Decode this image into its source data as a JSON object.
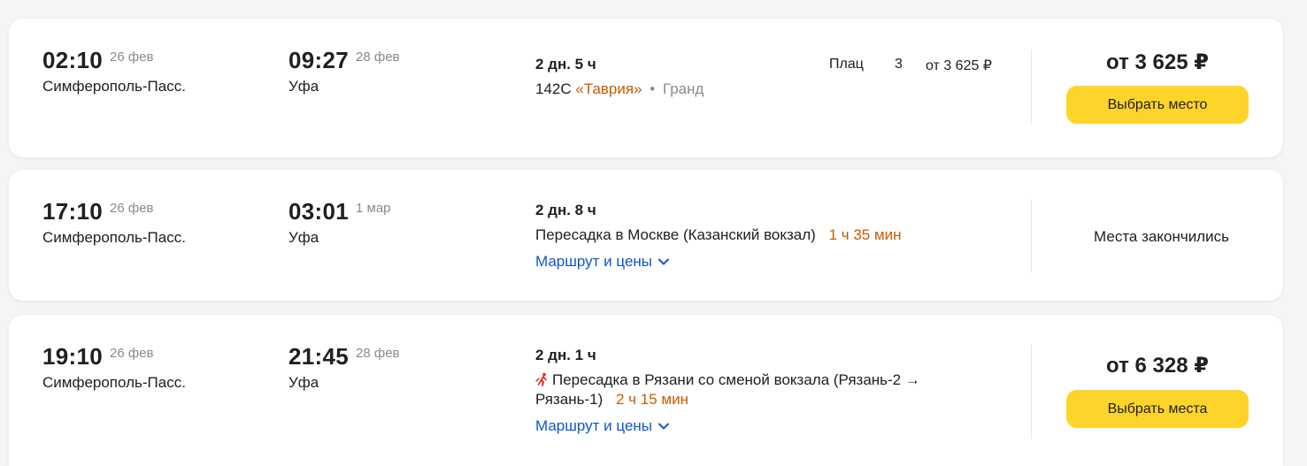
{
  "trains": [
    {
      "departure": {
        "time": "02:10",
        "date": "26 фев",
        "station": "Симферополь-Пасс."
      },
      "arrival": {
        "time": "09:27",
        "date": "28 фев",
        "station": "Уфа"
      },
      "duration": "2 дн. 5 ч",
      "train_number": "142С",
      "train_name": "«Таврия»",
      "separator": "•",
      "carrier": "Гранд",
      "seat_type": "Плац",
      "seat_count": "3",
      "seat_price": "от 3 625 ₽",
      "price": "от 3 625 ₽",
      "button_label": "Выбрать место"
    },
    {
      "departure": {
        "time": "17:10",
        "date": "26 фев",
        "station": "Симферополь-Пасс."
      },
      "arrival": {
        "time": "03:01",
        "date": "1 мар",
        "station": "Уфа"
      },
      "duration": "2 дн. 8 ч",
      "transfer_text": "Пересадка в Москве (Казанский вокзал)",
      "transfer_time": "1 ч 35 мин",
      "route_link": "Маршрут и цены",
      "status": "Места закончились"
    },
    {
      "departure": {
        "time": "19:10",
        "date": "26 фев",
        "station": "Симферополь-Пасс."
      },
      "arrival": {
        "time": "21:45",
        "date": "28 фев",
        "station": "Уфа"
      },
      "duration": "2 дн. 1 ч",
      "transfer_text_line1": "Пересадка в Рязани со сменой вокзала (Рязань-2 →",
      "transfer_text_line2": "Рязань-1)",
      "transfer_time": "2 ч 15 мин",
      "route_link": "Маршрут и цены",
      "price": "от 6 328 ₽",
      "button_label": "Выбрать места"
    }
  ],
  "colors": {
    "accent_button": "#fed42b",
    "link": "#0f56d1",
    "highlight": "#c95b00",
    "secondary_text": "#8b8a88"
  },
  "icons": {
    "chevron": "chevron-down-icon",
    "walk_transfer": "station-change-icon"
  }
}
